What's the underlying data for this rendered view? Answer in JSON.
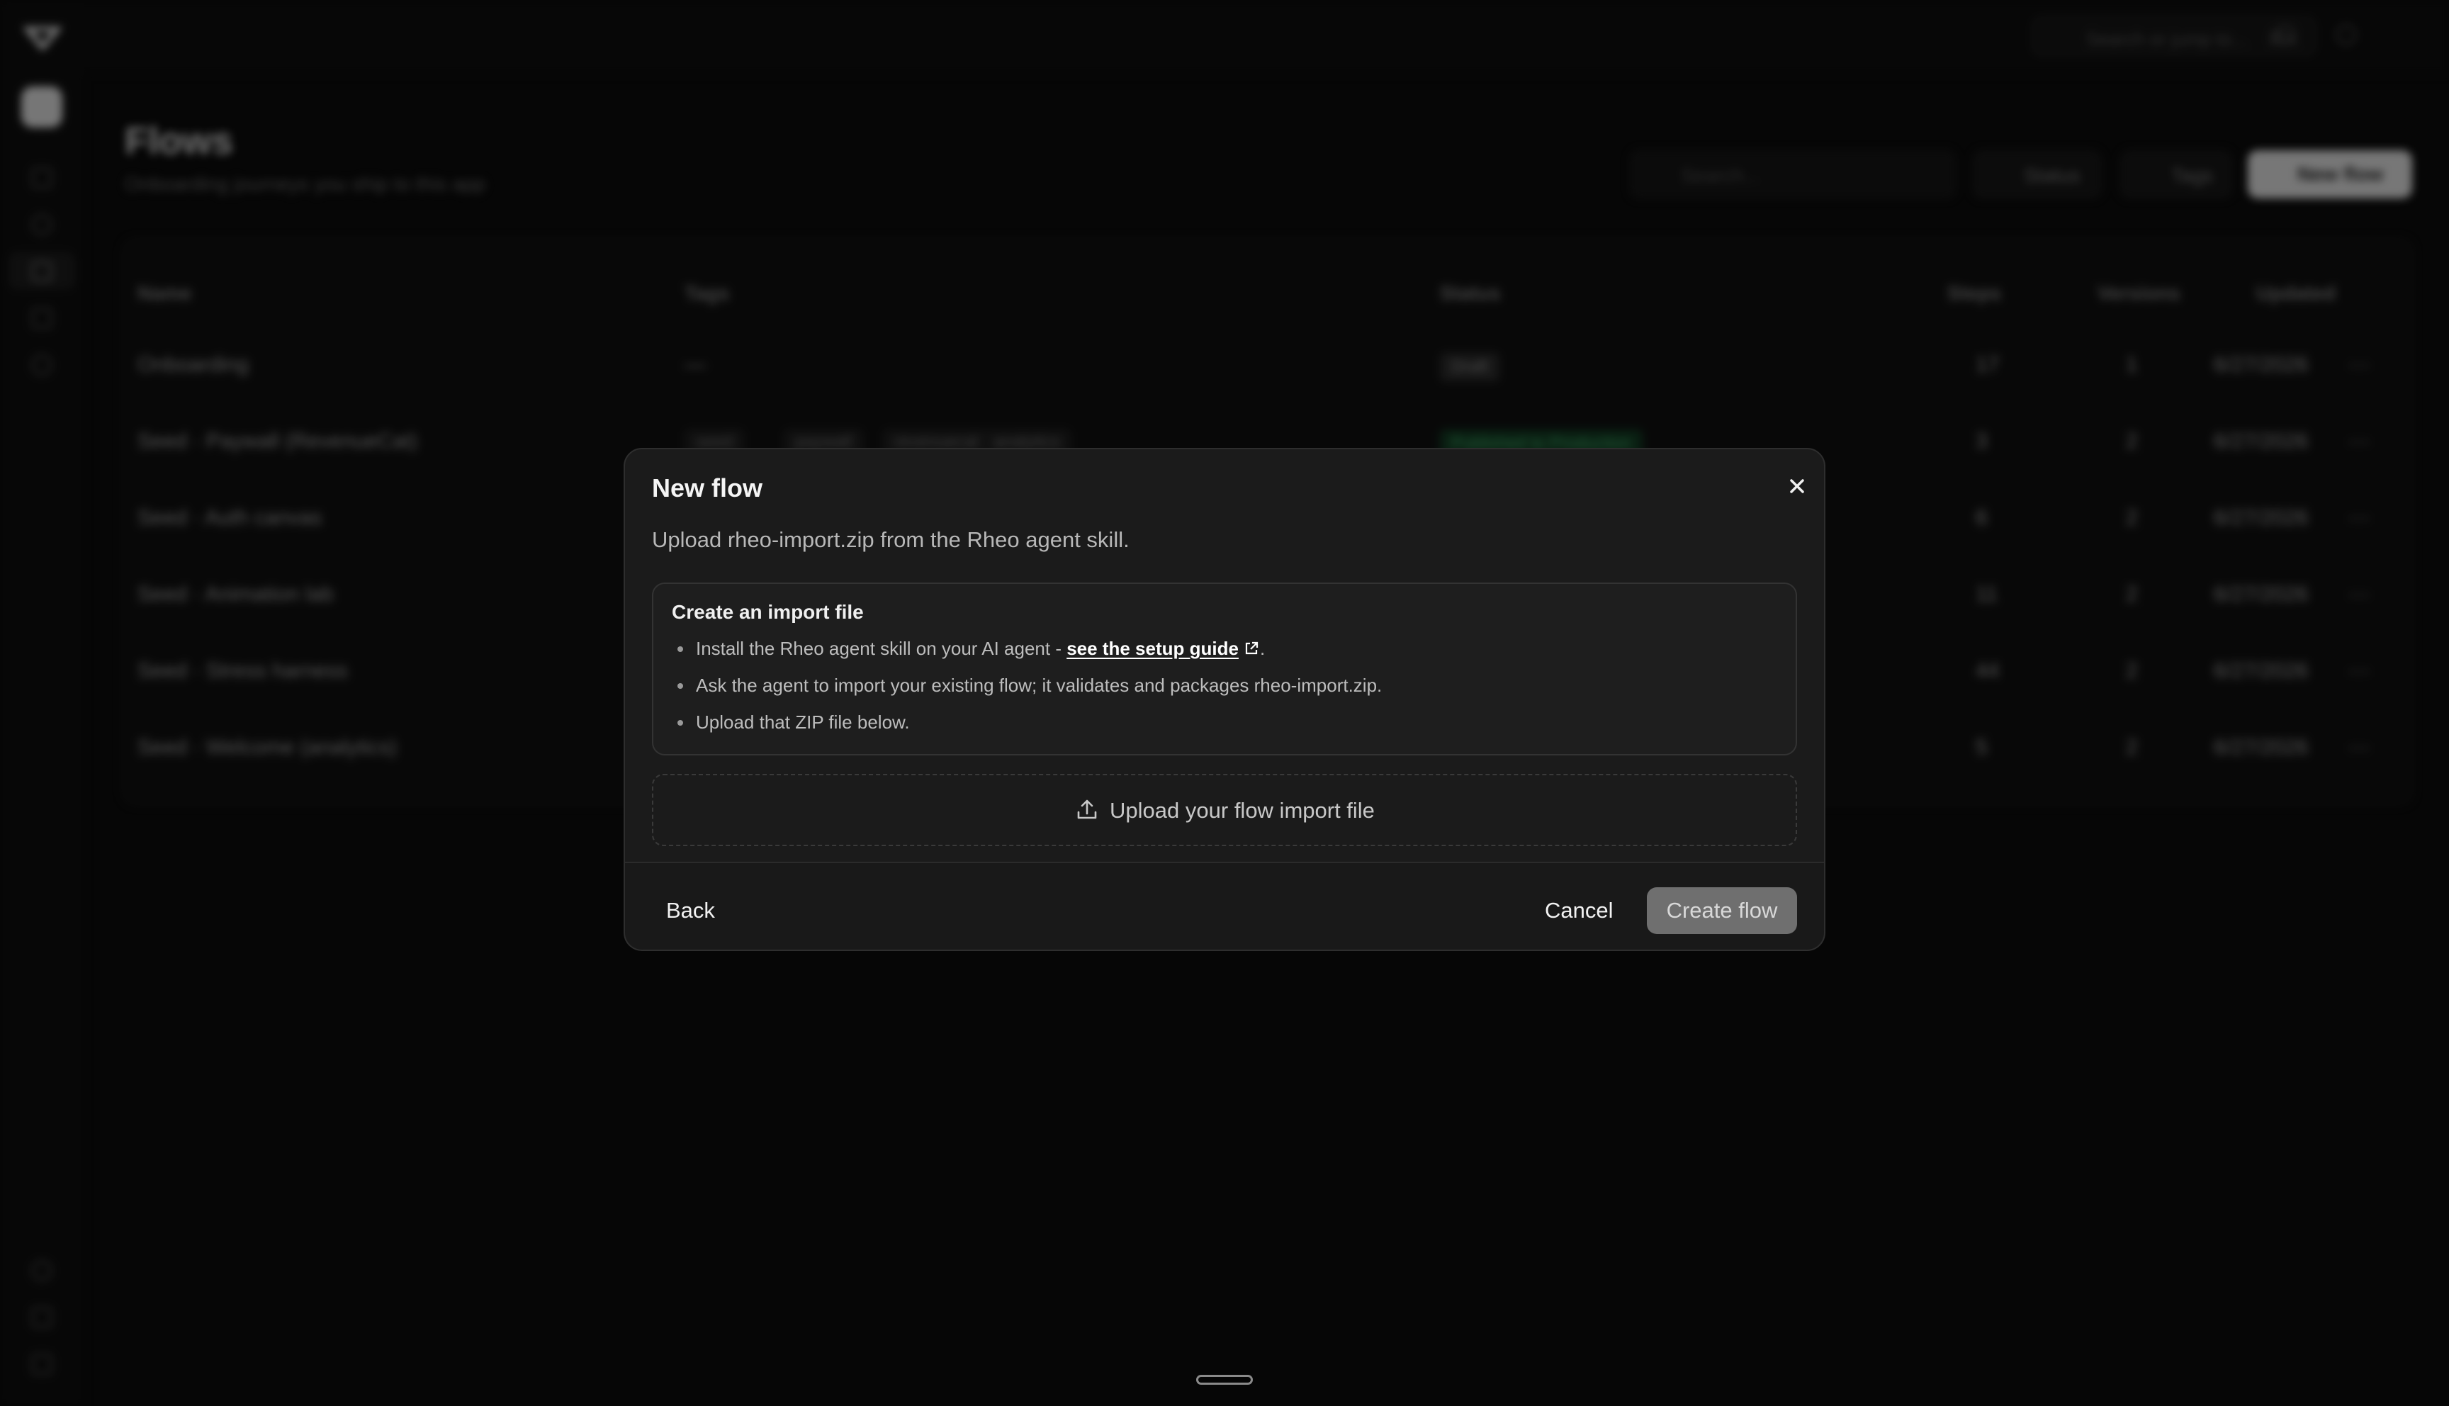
{
  "background": {
    "top_search_placeholder": "Search or jump to...",
    "top_search_shortcut": "⌘K",
    "page_title": "Flows",
    "page_subtitle": "Onboarding journeys you ship to this app",
    "search_placeholder": "Search...",
    "filter_status": "Status",
    "filter_tags": "Tags",
    "new_flow_button": "New flow",
    "columns": [
      "Name",
      "Tags",
      "Status",
      "Steps",
      "Versions",
      "Updated"
    ],
    "rows": [
      {
        "name": "Onboarding",
        "tags": [
          "—"
        ],
        "status": "Draft",
        "steps": "17",
        "versions": "1",
        "updated": "6/27/2026"
      },
      {
        "name": "Seed · Paywall (RevenueCat)",
        "tags": [
          "seed",
          "paywall",
          "revenuecat",
          "analytics"
        ],
        "status": "Published to Production",
        "steps": "3",
        "versions": "2",
        "updated": "6/27/2026"
      },
      {
        "name": "Seed · Auth canvas",
        "tags": [],
        "status": "",
        "steps": "6",
        "versions": "2",
        "updated": "6/27/2026"
      },
      {
        "name": "Seed · Animation lab",
        "tags": [],
        "status": "",
        "steps": "11",
        "versions": "2",
        "updated": "6/27/2026"
      },
      {
        "name": "Seed · Stress harness",
        "tags": [],
        "status": "",
        "steps": "44",
        "versions": "2",
        "updated": "6/27/2026"
      },
      {
        "name": "Seed · Welcome (analytics)",
        "tags": [],
        "status": "",
        "steps": "5",
        "versions": "2",
        "updated": "6/27/2026"
      }
    ]
  },
  "modal": {
    "title": "New flow",
    "description": "Upload rheo-import.zip from the Rheo agent skill.",
    "card_title": "Create an import file",
    "step1_prefix": "Install the Rheo agent skill on your AI agent - ",
    "step1_link": "see the setup guide",
    "step1_suffix": ".",
    "step2": "Ask the agent to import your existing flow; it validates and packages rheo-import.zip.",
    "step3": "Upload that ZIP file below.",
    "upload_label": "Upload your flow import file",
    "back_label": "Back",
    "cancel_label": "Cancel",
    "create_label": "Create flow"
  }
}
